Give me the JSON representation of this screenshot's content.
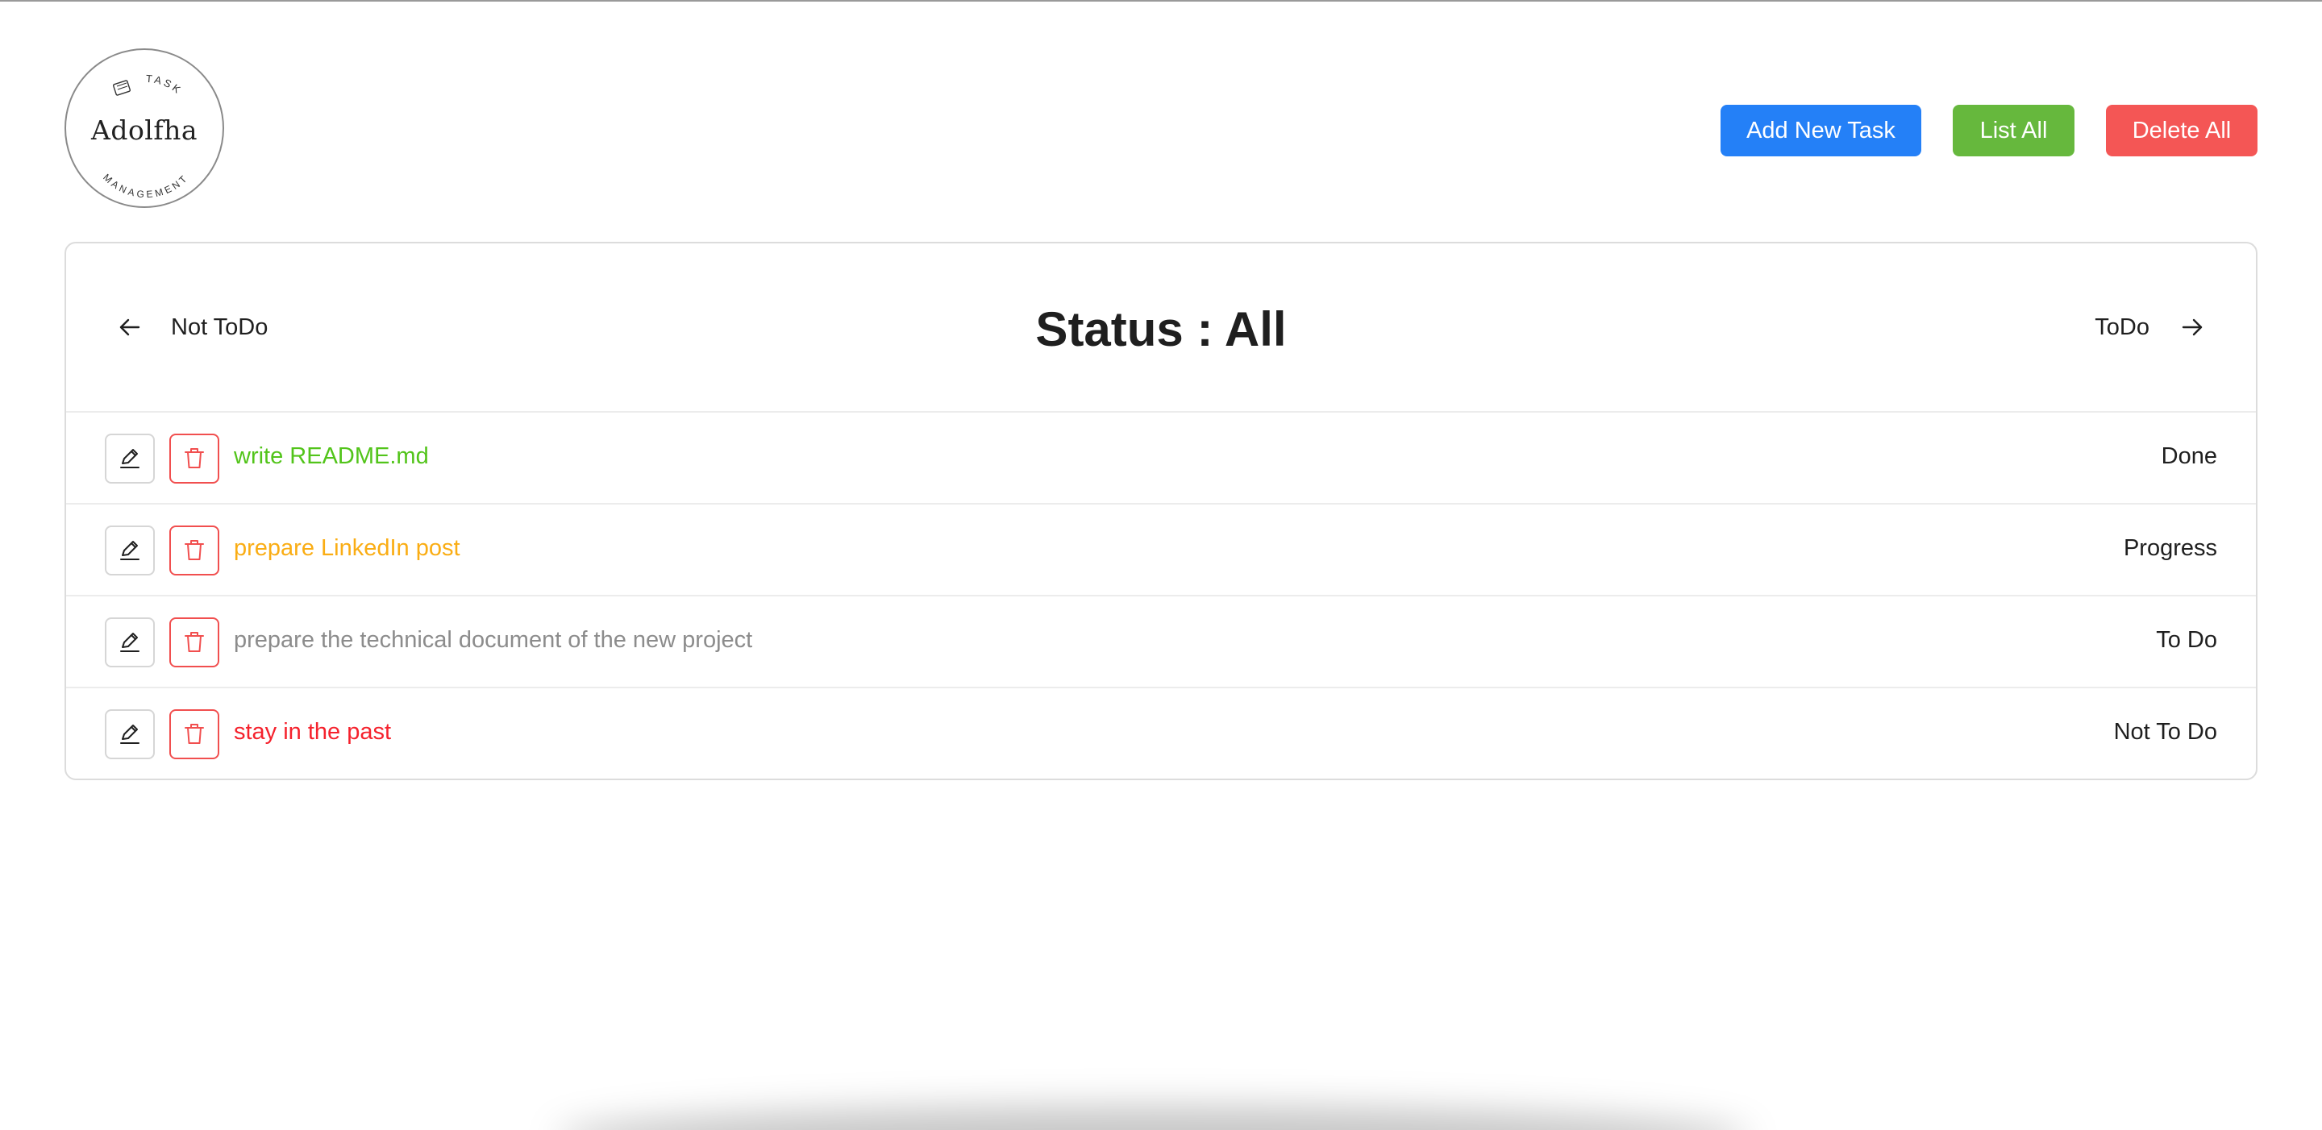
{
  "logo": {
    "top_text": "TASK",
    "name": "Adolfha",
    "bottom_text": "MANAGEMENT",
    "icon": "notepad-icon"
  },
  "toolbar": {
    "add_label": "Add New Task",
    "list_label": "List All",
    "delete_label": "Delete All"
  },
  "colors": {
    "add": "#2480f7",
    "list": "#66b83d",
    "delete": "#f45655",
    "done": "#52c41a",
    "progress": "#faad14",
    "todo": "#8c8c8c",
    "not_todo": "#f5222d"
  },
  "header": {
    "prev_label": "Not ToDo",
    "prev_icon": "arrow-left-icon",
    "title": "Status : All",
    "next_label": "ToDo",
    "next_icon": "arrow-right-icon"
  },
  "tasks": [
    {
      "name": "write README.md",
      "status": "Done",
      "color": "#52c41a"
    },
    {
      "name": "prepare LinkedIn post",
      "status": "Progress",
      "color": "#faad14"
    },
    {
      "name": "prepare the technical document of the new project",
      "status": "To Do",
      "color": "#8c8c8c"
    },
    {
      "name": "stay in the past",
      "status": "Not To Do",
      "color": "#f5222d"
    }
  ]
}
